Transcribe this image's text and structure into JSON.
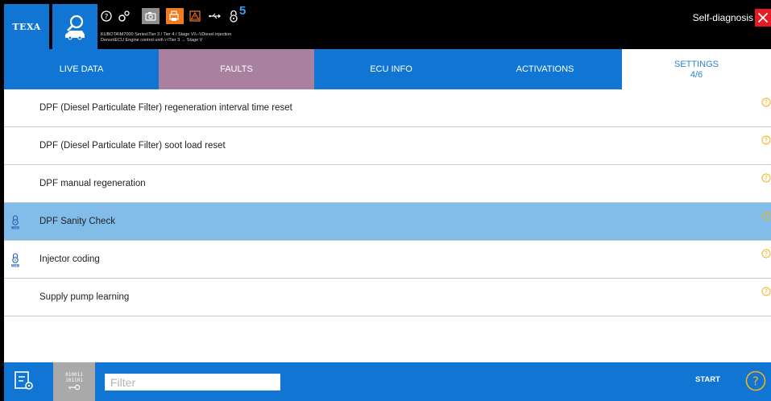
{
  "topbar": {
    "logo": "TEXA",
    "vehicle_path_line1": "KUBOTA\\M7000 Series\\Tier 3 / Tier 4 / Stage V\\\\--\\\\Diesel injection",
    "vehicle_path_line2": "Denso\\ECU Engine control unit\\-\\-\\Tier 3 → Stage V",
    "lock_count": "5",
    "section_title": "Self-diagnosis",
    "icons": [
      "vehicle-search-icon",
      "help-icon",
      "gears-icon",
      "camera-icon",
      "printer-icon",
      "warning-icon",
      "usb-icon",
      "lock-icon",
      "close-icon"
    ]
  },
  "tabs": [
    {
      "label": "LIVE DATA",
      "sub": ""
    },
    {
      "label": "FAULTS",
      "sub": ""
    },
    {
      "label": "ECU INFO",
      "sub": ""
    },
    {
      "label": "ACTIVATIONS",
      "sub": ""
    },
    {
      "label": "SETTINGS",
      "sub": "4/6"
    }
  ],
  "list": {
    "items": [
      {
        "label": "DPF (Diesel Particulate Filter) regeneration interval time reset",
        "locked": false,
        "selected": false
      },
      {
        "label": "DPF (Diesel Particulate Filter) soot load reset",
        "locked": false,
        "selected": false
      },
      {
        "label": "DPF manual regeneration",
        "locked": false,
        "selected": false
      },
      {
        "label": "DPF Sanity Check",
        "locked": true,
        "selected": true
      },
      {
        "label": "Injector coding",
        "locked": true,
        "selected": false
      },
      {
        "label": "Supply pump learning",
        "locked": false,
        "selected": false
      }
    ],
    "lock_badge": "WEB"
  },
  "bottombar": {
    "binary_line1": "010011",
    "binary_line2": "101101",
    "filter_placeholder": "Filter",
    "start_label": "START"
  },
  "colors": {
    "primary_blue": "#1176d3",
    "faults_tab": "#a980a0",
    "selected_row": "#82bce9",
    "help_yellow": "#f2b21b",
    "close_red": "#e31c23",
    "printer_orange": "#f07c22"
  }
}
